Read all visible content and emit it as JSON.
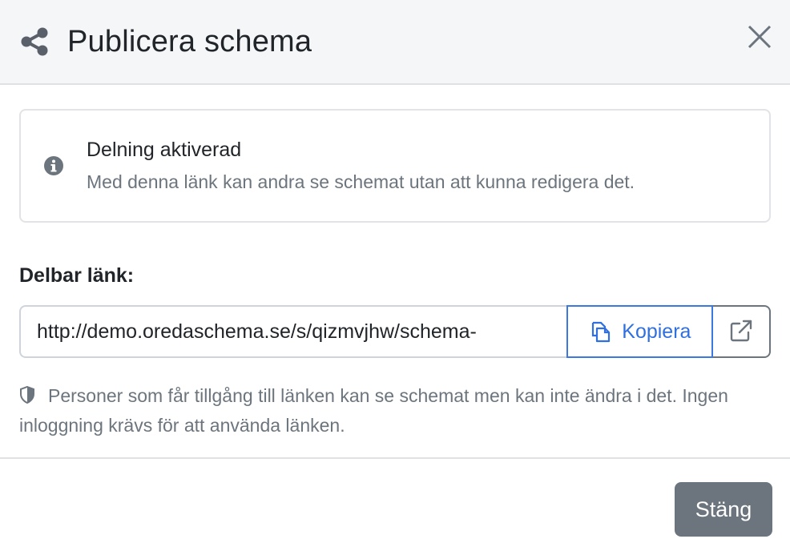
{
  "header": {
    "title": "Publicera schema",
    "icon": "share-icon",
    "close_icon": "close-icon"
  },
  "info": {
    "icon": "info-circle-icon",
    "title": "Delning aktiverad",
    "description": "Med denna länk kan andra se schemat utan att kunna redigera det."
  },
  "link": {
    "label": "Delbar länk:",
    "value": "http://demo.oredaschema.se/s/qizmvjhw/schema-",
    "copy_label": "Kopiera",
    "copy_icon": "copy-icon",
    "open_icon": "external-link-icon"
  },
  "note": {
    "icon": "shield-icon",
    "text": "Personer som får tillgång till länken kan se schemat men kan inte ändra i det. Ingen inloggning krävs för att använda länken."
  },
  "footer": {
    "close_label": "Stäng"
  },
  "colors": {
    "accent": "#2f6fe0",
    "secondary": "#6c757d",
    "header_bg": "#f5f6f8"
  }
}
